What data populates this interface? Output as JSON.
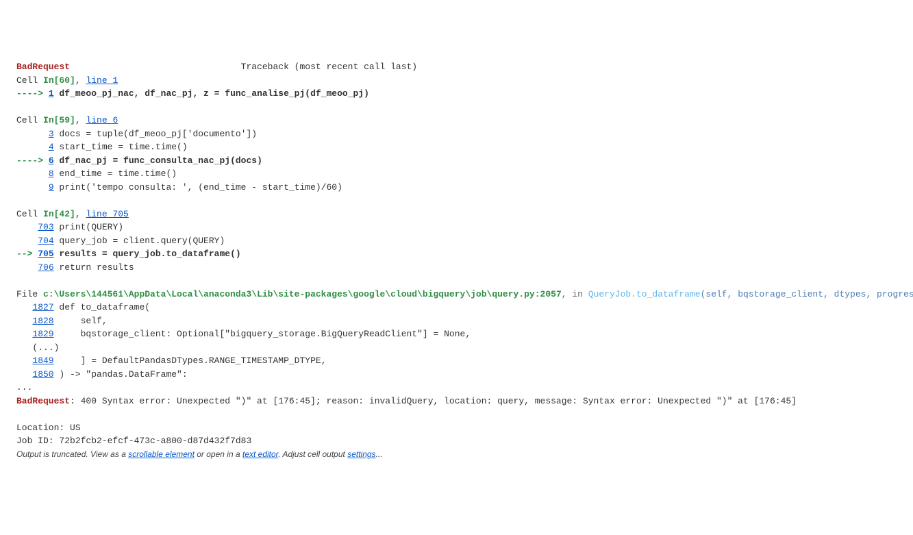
{
  "header": {
    "exception": "BadRequest",
    "traceback_label": "Traceback (most recent call last)"
  },
  "frames": [
    {
      "cell_prefix": "Cell ",
      "in_label": "In[60]",
      "sep": ", ",
      "line_label": "line 1",
      "lines": [
        {
          "arrow": "----> ",
          "num": "1",
          "code": " df_meoo_pj_nac, df_nac_pj, z = func_analise_pj(df_meoo_pj)",
          "bold": true
        }
      ]
    },
    {
      "cell_prefix": "Cell ",
      "in_label": "In[59]",
      "sep": ", ",
      "line_label": "line 6",
      "lines": [
        {
          "arrow": "      ",
          "num": "3",
          "code": " docs = tuple(df_meoo_pj['documento'])"
        },
        {
          "arrow": "      ",
          "num": "4",
          "code": " start_time = time.time()"
        },
        {
          "arrow": "----> ",
          "num": "6",
          "code": " df_nac_pj = func_consulta_nac_pj(docs)",
          "bold": true
        },
        {
          "arrow": "      ",
          "num": "8",
          "code": " end_time = time.time()"
        },
        {
          "arrow": "      ",
          "num": "9",
          "code": " print('tempo consulta: ', (end_time - start_time)/60)"
        }
      ]
    },
    {
      "cell_prefix": "Cell ",
      "in_label": "In[42]",
      "sep": ", ",
      "line_label": "line 705",
      "lines": [
        {
          "arrow": "    ",
          "num": "703",
          "code": " print(QUERY)"
        },
        {
          "arrow": "    ",
          "num": "704",
          "code": " query_job = client.query(QUERY)"
        },
        {
          "arrow": "--> ",
          "num": "705",
          "code": " results = query_job.to_dataframe()",
          "bold": true
        },
        {
          "arrow": "    ",
          "num": "706",
          "code": " return results"
        }
      ]
    }
  ],
  "file_frame": {
    "prefix": "File ",
    "path": "c:\\Users\\144561\\AppData\\Local\\anaconda3\\Lib\\site-packages\\google\\cloud\\bigquery\\job\\query.py:2057",
    "in_text": ", in ",
    "method": "QueryJob.to_dataframe",
    "paren_open": "(",
    "args": "self, bqstorage_client, dtypes, progress_",
    "lines": [
      {
        "num": "1827",
        "code": " def to_dataframe("
      },
      {
        "num": "1828",
        "code": "     self,"
      },
      {
        "num": "1829",
        "code": "     bqstorage_client: Optional[\"bigquery_storage.BigQueryReadClient\"] = None,"
      }
    ],
    "ellipsis": "   (...)",
    "lines2": [
      {
        "num": "1849",
        "code": "     ] = DefaultPandasDTypes.RANGE_TIMESTAMP_DTYPE,"
      },
      {
        "num": "1850",
        "code": " ) -> \"pandas.DataFrame\":"
      }
    ]
  },
  "tail": {
    "dots": "...",
    "err_name": "BadRequest",
    "err_msg": ": 400 Syntax error: Unexpected \")\" at [176:45]; reason: invalidQuery, location: query, message: Syntax error: Unexpected \")\" at [176:45]",
    "location": "Location: US",
    "jobid": "Job ID: 72b2fcb2-efcf-473c-a800-d87d432f7d83"
  },
  "trunc": {
    "t1": "Output is truncated. View as a ",
    "l1": "scrollable element",
    "t2": " or open in a ",
    "l2": "text editor",
    "t3": ". Adjust cell output ",
    "l3": "settings",
    "t4": "..."
  }
}
